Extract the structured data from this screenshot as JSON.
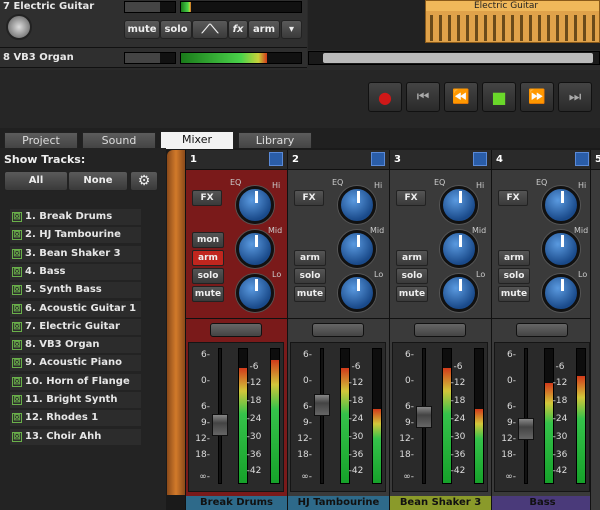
{
  "tracks_top": [
    {
      "title": "7 Electric Guitar",
      "mute": "mute",
      "solo": "solo",
      "fx": "fx",
      "arm": "arm",
      "menu": "▾"
    },
    {
      "title": "8 VB3 Organ"
    }
  ],
  "clip": {
    "label": "Electric Guitar"
  },
  "transport": {
    "record": "●",
    "rewind_start": "⏮",
    "rewind": "⏪",
    "play": "■",
    "forward": "⏩",
    "end": "⏭"
  },
  "tabs": [
    "Project",
    "Sound",
    "Mixer",
    "Library"
  ],
  "show_tracks": {
    "label": "Show Tracks:",
    "all": "All",
    "none": "None",
    "gear": "⚙"
  },
  "track_list": [
    "1. Break Drums",
    "2. HJ Tambourine",
    "3. Bean Shaker 3",
    "4. Bass",
    "5. Synth Bass",
    "6. Acoustic Guitar 1",
    "7. Electric Guitar",
    "8. VB3 Organ",
    "9. Acoustic Piano",
    "10. Horn of Flange",
    "11. Bright Synth Or...",
    "12. Rhodes 1",
    "13. Choir Ahh"
  ],
  "check": "⊠",
  "eq": {
    "eq": "EQ",
    "hi": "Hi",
    "mid": "Mid",
    "lo": "Lo"
  },
  "strip_btns": {
    "fx": "FX",
    "mon": "mon",
    "arm": "arm",
    "solo": "solo",
    "mute": "mute"
  },
  "scale": [
    "6-",
    "0-",
    "6-",
    "9-",
    "12-",
    "18-",
    "∞-"
  ],
  "meter_scale": [
    "-6",
    "-12",
    "-18",
    "-24",
    "-30",
    "-36",
    "-42"
  ],
  "strips": [
    {
      "num": "1",
      "name": "Break Drums",
      "fader": 0.45,
      "meterL": 0.86,
      "meterR": 0.92,
      "has_mon": true,
      "armed": true,
      "bg": "#7a1a1a",
      "namebg": "#2e6a8a"
    },
    {
      "num": "2",
      "name": "HJ Tambourine",
      "fader": 0.62,
      "meterL": 0.86,
      "meterR": 0.55,
      "has_mon": false,
      "armed": false,
      "bg": "#3a3a3a",
      "namebg": "#2e6a8a"
    },
    {
      "num": "3",
      "name": "Bean Shaker 3",
      "fader": 0.52,
      "meterL": 0.86,
      "meterR": 0.55,
      "has_mon": false,
      "armed": false,
      "bg": "#3a3a3a",
      "namebg": "#8a9a2a"
    },
    {
      "num": "4",
      "name": "Bass",
      "fader": 0.42,
      "meterL": 0.75,
      "meterR": 0.8,
      "has_mon": false,
      "armed": false,
      "bg": "#3a3a3a",
      "namebg": "#4a3a7a"
    }
  ],
  "fifth_strip": {
    "num": "5"
  }
}
